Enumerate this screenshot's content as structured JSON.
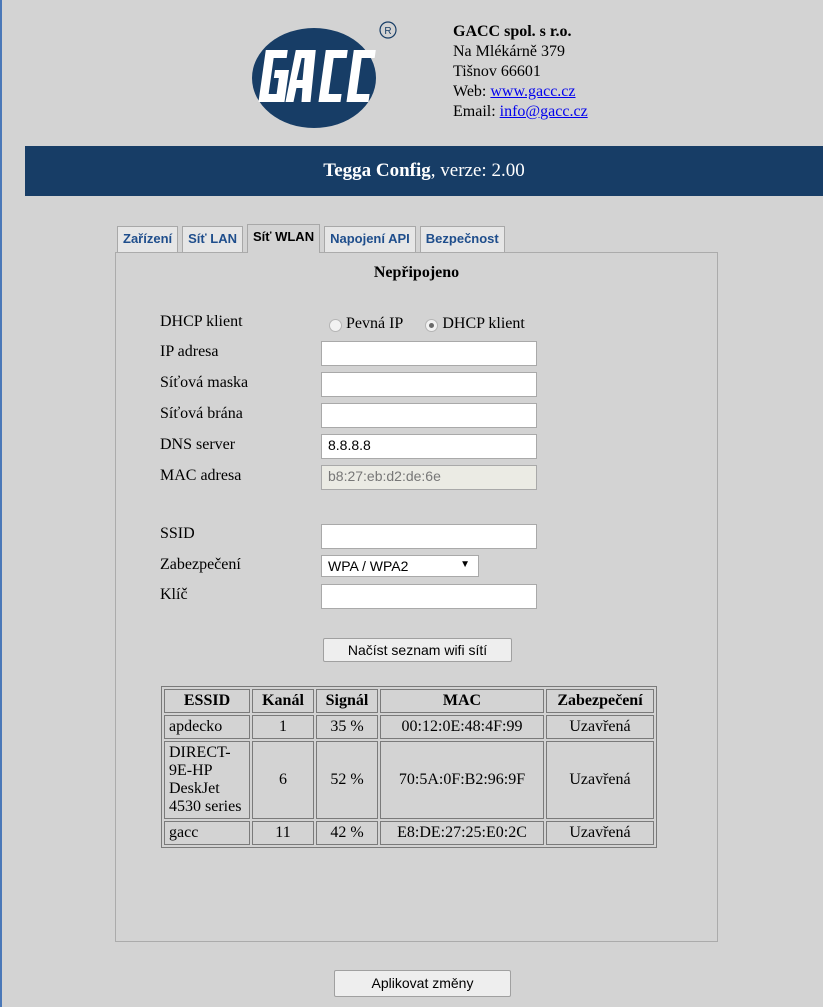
{
  "header": {
    "logo_text": "GACC",
    "registered_mark": "®",
    "company_name": "GACC spol. s r.o.",
    "street": "Na Mlékárně 379",
    "city": "Tišnov 66601",
    "web_label": "Web: ",
    "web_link": "www.gacc.cz",
    "email_label": "Email: ",
    "email_link": "info@gacc.cz"
  },
  "titlebar": {
    "app": "Tegga Config",
    "version_text": ", verze: 2.00"
  },
  "tabs": [
    {
      "label": "Zařízení"
    },
    {
      "label": "Síť LAN"
    },
    {
      "label": "Síť WLAN",
      "active": true
    },
    {
      "label": "Napojení API"
    },
    {
      "label": "Bezpečnost"
    }
  ],
  "panel": {
    "status": "Nepřipojeno",
    "dhcp_label": "DHCP klient",
    "radio_static": "Pevná IP",
    "radio_dhcp": "DHCP klient",
    "ip_label": "IP adresa",
    "ip_value": "",
    "mask_label": "Síťová maska",
    "mask_value": "",
    "gateway_label": "Síťová brána",
    "gateway_value": "",
    "dns_label": "DNS server",
    "dns_value": "8.8.8.8",
    "mac_label": "MAC adresa",
    "mac_value": "b8:27:eb:d2:de:6e",
    "ssid_label": "SSID",
    "ssid_value": "",
    "security_label": "Zabezpečení",
    "security_value": "WPA / WPA2",
    "key_label": "Klíč",
    "key_value": "",
    "scan_button": "Načíst seznam wifi sítí"
  },
  "wifi_table": {
    "headers": [
      "ESSID",
      "Kanál",
      "Signál",
      "MAC",
      "Zabezpečení"
    ],
    "rows": [
      {
        "essid": "apdecko",
        "channel": "1",
        "signal": "35 %",
        "mac": "00:12:0E:48:4F:99",
        "security": "Uzavřená"
      },
      {
        "essid": "DIRECT-9E-HP DeskJet 4530 series",
        "channel": "6",
        "signal": "52 %",
        "mac": "70:5A:0F:B2:96:9F",
        "security": "Uzavřená"
      },
      {
        "essid": "gacc",
        "channel": "11",
        "signal": "42 %",
        "mac": "E8:DE:27:25:E0:2C",
        "security": "Uzavřená"
      }
    ]
  },
  "apply_button": "Aplikovat změny",
  "colors": {
    "titlebar": "#173d66",
    "tab_text": "#1f4e8c",
    "background": "#d3d3d3"
  }
}
